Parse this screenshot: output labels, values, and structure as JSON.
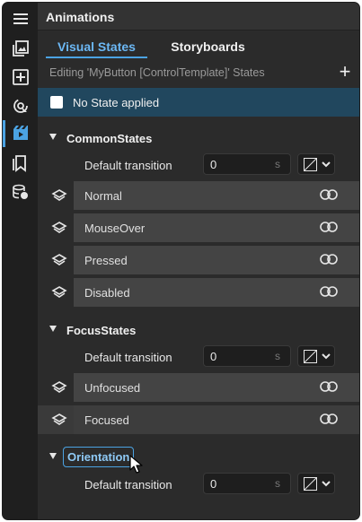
{
  "panel": {
    "title": "Animations",
    "tabs": [
      {
        "label": "Visual States",
        "active": true
      },
      {
        "label": "Storyboards",
        "active": false
      }
    ],
    "editing_label": "Editing 'MyButton [ControlTemplate]' States",
    "add_label": "+",
    "base_state": {
      "label": "No State applied",
      "checked": false
    }
  },
  "rail": {
    "icons": [
      "hamburger-icon",
      "gallery-icon",
      "add-box-icon",
      "bindings-icon",
      "animations-icon",
      "bookmark-icon",
      "data-icon"
    ],
    "active_index": 4
  },
  "groups": [
    {
      "name": "CommonStates",
      "transition_label": "Default transition",
      "transition_value": "0",
      "transition_unit": "s",
      "states": [
        "Normal",
        "MouseOver",
        "Pressed",
        "Disabled"
      ]
    },
    {
      "name": "FocusStates",
      "transition_label": "Default transition",
      "transition_value": "0",
      "transition_unit": "s",
      "states": [
        "Unfocused",
        "Focused"
      ]
    },
    {
      "name": "Orientation",
      "transition_label": "Default transition",
      "transition_value": "0",
      "transition_unit": "s",
      "states": []
    }
  ],
  "colors": {
    "accent": "#4ba3e3",
    "base_row": "#21475e",
    "background": "#2b2b2b"
  }
}
